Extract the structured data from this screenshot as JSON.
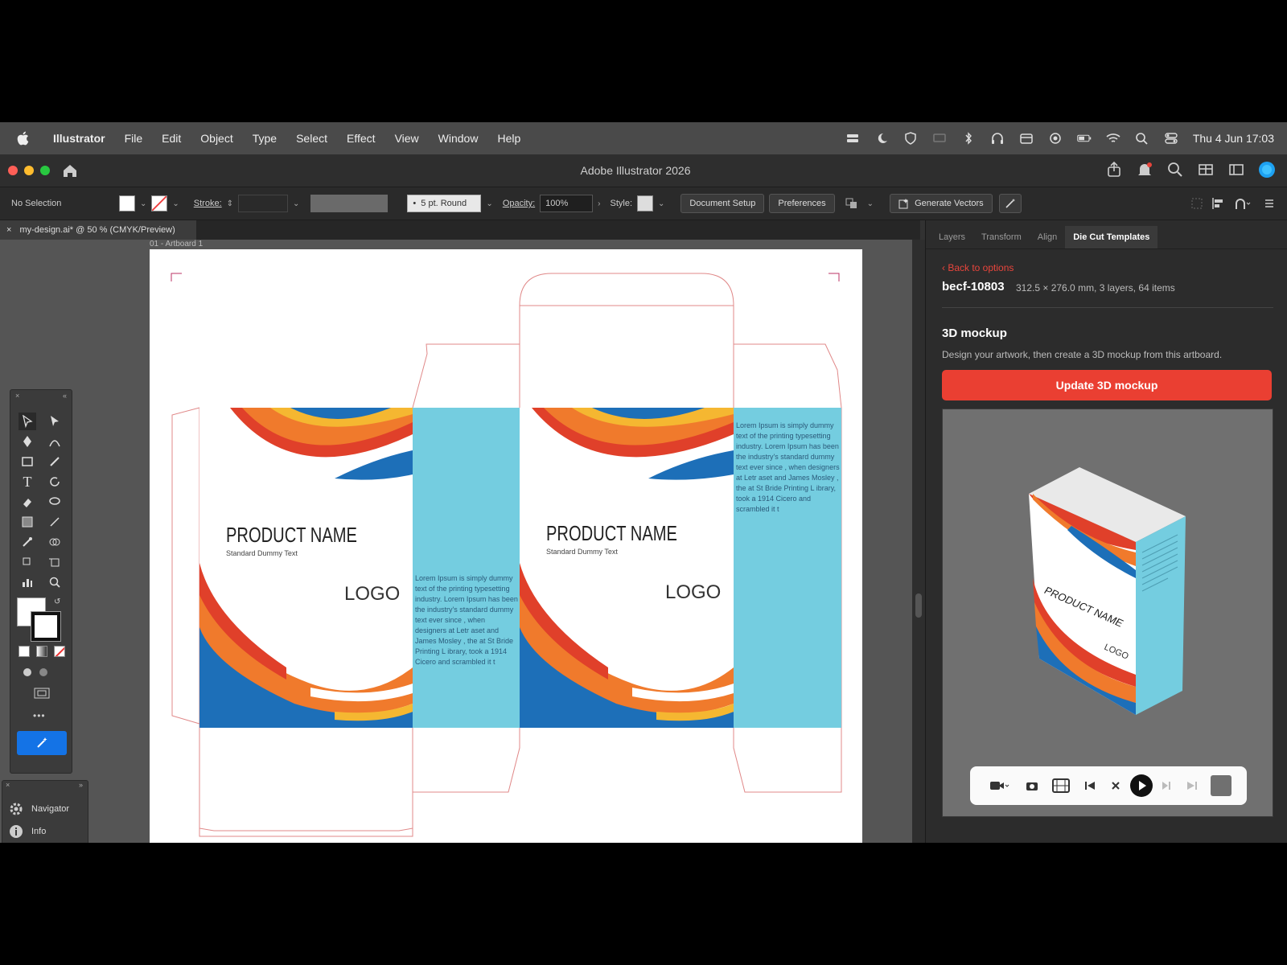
{
  "menubar": {
    "app_name": "Illustrator",
    "items": [
      "File",
      "Edit",
      "Object",
      "Type",
      "Select",
      "Effect",
      "View",
      "Window",
      "Help"
    ],
    "clock": "Thu 4 Jun  17:03"
  },
  "window": {
    "title": "Adobe Illustrator 2026"
  },
  "controlbar": {
    "selection": "No Selection",
    "stroke_label": "Stroke:",
    "brush_value": "5 pt. Round",
    "opacity_label": "Opacity:",
    "opacity_value": "100%",
    "style_label": "Style:",
    "document_setup": "Document Setup",
    "preferences": "Preferences",
    "generate_vectors": "Generate Vectors"
  },
  "document": {
    "tab_label": "my-design.ai* @ 50 % (CMYK/Preview)",
    "artboard_label": "01 - Artboard 1"
  },
  "artwork": {
    "product_name": "PRODUCT NAME",
    "subtitle": "Standard Dummy Text",
    "logo": "LOGO",
    "side_text_left": "Lorem Ipsum is simply dummy text of the printing typesetting industry. Lorem Ipsum has been the industry's standard dummy text ever since , when designers at Letr aset and James Mosley , the at St Bride Printing L ibrary, took a 1914 Cicero and scrambled it t",
    "side_text_right": "Lorem Ipsum is simply dummy text of the printing typesetting industry. Lorem Ipsum has been the industry's standard dummy text ever since , when designers at Letr aset and James Mosley , the at St Bride Printing L ibrary, took a 1914 Cicero and scrambled it t",
    "colors": {
      "light_blue": "#74cde0",
      "blue": "#1d6fb8",
      "orange": "#f07a2c",
      "red": "#e0402a",
      "yellow": "#f5b731"
    }
  },
  "tools_panel": {
    "navigator": "Navigator",
    "info": "Info"
  },
  "right_panel": {
    "tabs": [
      "Layers",
      "Transform",
      "Align",
      "Die Cut Templates"
    ],
    "active_tab": "Die Cut Templates",
    "back_link": "‹ Back to options",
    "template_id": "becf-10803",
    "template_meta": "312.5 × 276.0 mm, 3 layers, 64 items",
    "mockup_heading": "3D mockup",
    "mockup_desc": "Design your artwork, then create a 3D mockup from this artboard.",
    "update_button": "Update 3D mockup",
    "mockup_product_name": "PRODUCT NAME",
    "mockup_logo": "LOGO"
  },
  "accent_colors": {
    "primary": "#ea3f32",
    "link": "#e8453c"
  }
}
